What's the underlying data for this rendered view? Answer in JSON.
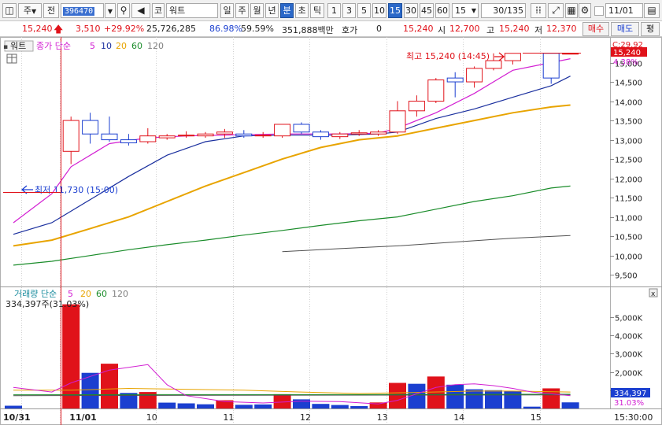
{
  "toolbar": {
    "market_type": "주",
    "prev_label": "전",
    "stock_code": "396470",
    "market_badge": "코",
    "stock_name": "워트",
    "period_buttons": [
      "일",
      "주",
      "월",
      "년",
      "분",
      "초",
      "틱"
    ],
    "selected_period": "분",
    "interval_buttons": [
      "1",
      "3",
      "5",
      "10",
      "15",
      "30",
      "45",
      "60"
    ],
    "selected_interval": "15",
    "interval_select": "15",
    "page_count": "30/135",
    "date": "11/01"
  },
  "quote": {
    "price": "15,240",
    "change": "3,510",
    "change_pct": "+29.92%",
    "volume": "25,726,285",
    "ratio1": "86.98%",
    "ratio2": "59.59%",
    "amount": "351,888백만",
    "hoga_label": "호가",
    "hoga_value": "0",
    "hoga_price": "15,240",
    "open_label": "시",
    "open": "12,700",
    "high_label": "고",
    "high": "15,240",
    "low_label": "저",
    "low": "12,370",
    "buy_button": "매수",
    "sell_button": "매도",
    "eval_button": "평"
  },
  "colors": {
    "up": "#e0121a",
    "down": "#1b3fd0",
    "ma5": "#d21ed2",
    "ma10": "#1a2f9e",
    "ma20": "#e8a400",
    "ma60": "#1a8c2a",
    "ma120": "#505050"
  },
  "price_panel": {
    "name_tag": "워트",
    "legend_title": "종가 단순",
    "legend_periods": [
      "5",
      "10",
      "20",
      "60",
      "120"
    ],
    "high_marker": "최고 15,240 (14:45)",
    "low_marker": "최저 11,730 (15:00)",
    "current_pct": "C:29.92",
    "current_price_tag": "15,240",
    "pct_tag": "4.38%"
  },
  "volume_panel": {
    "legend_title": "거래량 단순",
    "legend_periods": [
      "5",
      "20",
      "60",
      "120"
    ],
    "info": "334,397주(31.03%)",
    "current_tag": "334,397",
    "pct_tag": "31.03%",
    "close_icon": "x"
  },
  "time_axis": {
    "labels": [
      "10/31",
      "11/01",
      "10",
      "11",
      "12",
      "13",
      "14",
      "15"
    ],
    "last_time": "15:30:00"
  },
  "chart_data": {
    "type": "candlestick",
    "y_axis_ticks": [
      9500,
      10000,
      10500,
      11000,
      11500,
      12000,
      12500,
      13000,
      13500,
      14000,
      14500,
      15000
    ],
    "ylim": [
      9300,
      15500
    ],
    "volume_ticks": [
      "1,000K",
      "2,000K",
      "3,000K",
      "4,000K",
      "5,000K"
    ],
    "volume_ylim": [
      0,
      5900000
    ],
    "x_slots": 29,
    "candles": [
      {
        "i": 3,
        "o": 12700,
        "h": 13600,
        "l": 12370,
        "c": 13500
      },
      {
        "i": 4,
        "o": 13500,
        "h": 13700,
        "l": 12900,
        "c": 13150
      },
      {
        "i": 5,
        "o": 13150,
        "h": 13600,
        "l": 12950,
        "c": 13000
      },
      {
        "i": 6,
        "o": 13000,
        "h": 13150,
        "l": 12850,
        "c": 12920
      },
      {
        "i": 7,
        "o": 12950,
        "h": 13300,
        "l": 12900,
        "c": 13100
      },
      {
        "i": 8,
        "o": 13050,
        "h": 13150,
        "l": 13000,
        "c": 13100
      },
      {
        "i": 9,
        "o": 13100,
        "h": 13220,
        "l": 13050,
        "c": 13120
      },
      {
        "i": 10,
        "o": 13100,
        "h": 13200,
        "l": 13050,
        "c": 13150
      },
      {
        "i": 11,
        "o": 13150,
        "h": 13280,
        "l": 13050,
        "c": 13200
      },
      {
        "i": 12,
        "o": 13150,
        "h": 13250,
        "l": 13050,
        "c": 13100
      },
      {
        "i": 13,
        "o": 13100,
        "h": 13200,
        "l": 13050,
        "c": 13120
      },
      {
        "i": 14,
        "o": 13100,
        "h": 13400,
        "l": 13050,
        "c": 13400
      },
      {
        "i": 15,
        "o": 13400,
        "h": 13450,
        "l": 13150,
        "c": 13200
      },
      {
        "i": 16,
        "o": 13200,
        "h": 13250,
        "l": 13000,
        "c": 13080
      },
      {
        "i": 17,
        "o": 13080,
        "h": 13200,
        "l": 13020,
        "c": 13150
      },
      {
        "i": 18,
        "o": 13150,
        "h": 13250,
        "l": 13100,
        "c": 13180
      },
      {
        "i": 19,
        "o": 13150,
        "h": 13250,
        "l": 13100,
        "c": 13200
      },
      {
        "i": 20,
        "o": 13200,
        "h": 14000,
        "l": 13150,
        "c": 13750
      },
      {
        "i": 21,
        "o": 13750,
        "h": 14150,
        "l": 13600,
        "c": 14000
      },
      {
        "i": 22,
        "o": 14000,
        "h": 14600,
        "l": 13950,
        "c": 14550
      },
      {
        "i": 23,
        "o": 14600,
        "h": 14750,
        "l": 14100,
        "c": 14500
      },
      {
        "i": 24,
        "o": 14500,
        "h": 14900,
        "l": 14350,
        "c": 14850
      },
      {
        "i": 25,
        "o": 14850,
        "h": 15240,
        "l": 14800,
        "c": 15050
      },
      {
        "i": 26,
        "o": 15050,
        "h": 15240,
        "l": 14950,
        "c": 15240
      },
      {
        "i": 28,
        "o": 15240,
        "h": 15240,
        "l": 14450,
        "c": 14600
      },
      {
        "i": 29,
        "o": 15240,
        "h": 15240,
        "l": 15240,
        "c": 15240
      }
    ],
    "ma5": [
      [
        0,
        10850
      ],
      [
        2,
        11600
      ],
      [
        3,
        12300
      ],
      [
        5,
        12900
      ],
      [
        7,
        13050
      ],
      [
        9,
        13100
      ],
      [
        11,
        13120
      ],
      [
        14,
        13150
      ],
      [
        17,
        13150
      ],
      [
        19,
        13170
      ],
      [
        20,
        13300
      ],
      [
        22,
        13700
      ],
      [
        24,
        14200
      ],
      [
        26,
        14800
      ],
      [
        28,
        15000
      ],
      [
        29,
        15100
      ]
    ],
    "ma10": [
      [
        0,
        10550
      ],
      [
        2,
        10850
      ],
      [
        4,
        11450
      ],
      [
        6,
        12050
      ],
      [
        8,
        12600
      ],
      [
        10,
        12950
      ],
      [
        12,
        13100
      ],
      [
        14,
        13120
      ],
      [
        17,
        13120
      ],
      [
        19,
        13150
      ],
      [
        20,
        13200
      ],
      [
        22,
        13550
      ],
      [
        24,
        13800
      ],
      [
        26,
        14100
      ],
      [
        28,
        14400
      ],
      [
        29,
        14650
      ]
    ],
    "ma20": [
      [
        0,
        10250
      ],
      [
        2,
        10400
      ],
      [
        4,
        10700
      ],
      [
        6,
        11000
      ],
      [
        8,
        11400
      ],
      [
        10,
        11800
      ],
      [
        12,
        12150
      ],
      [
        14,
        12500
      ],
      [
        16,
        12800
      ],
      [
        18,
        13000
      ],
      [
        20,
        13100
      ],
      [
        22,
        13300
      ],
      [
        24,
        13500
      ],
      [
        26,
        13700
      ],
      [
        28,
        13850
      ],
      [
        29,
        13900
      ]
    ],
    "ma60": [
      [
        0,
        9750
      ],
      [
        2,
        9850
      ],
      [
        4,
        10000
      ],
      [
        6,
        10150
      ],
      [
        8,
        10280
      ],
      [
        10,
        10400
      ],
      [
        12,
        10530
      ],
      [
        14,
        10650
      ],
      [
        16,
        10780
      ],
      [
        18,
        10900
      ],
      [
        20,
        11000
      ],
      [
        22,
        11200
      ],
      [
        24,
        11400
      ],
      [
        26,
        11550
      ],
      [
        28,
        11750
      ],
      [
        29,
        11800
      ]
    ],
    "ma120": [
      [
        14,
        10100
      ],
      [
        17,
        10180
      ],
      [
        20,
        10250
      ],
      [
        23,
        10350
      ],
      [
        26,
        10450
      ],
      [
        29,
        10520
      ]
    ],
    "volume": [
      {
        "i": 0,
        "v": 150000,
        "up": false
      },
      {
        "i": 3,
        "v": 5700000,
        "up": true
      },
      {
        "i": 4,
        "v": 1950000,
        "up": false
      },
      {
        "i": 5,
        "v": 2450000,
        "up": true
      },
      {
        "i": 6,
        "v": 850000,
        "up": false
      },
      {
        "i": 7,
        "v": 900000,
        "up": true
      },
      {
        "i": 8,
        "v": 320000,
        "up": false
      },
      {
        "i": 9,
        "v": 280000,
        "up": false
      },
      {
        "i": 10,
        "v": 230000,
        "up": false
      },
      {
        "i": 11,
        "v": 450000,
        "up": true
      },
      {
        "i": 12,
        "v": 200000,
        "up": false
      },
      {
        "i": 13,
        "v": 220000,
        "up": false
      },
      {
        "i": 14,
        "v": 780000,
        "up": true
      },
      {
        "i": 15,
        "v": 500000,
        "up": false
      },
      {
        "i": 16,
        "v": 250000,
        "up": false
      },
      {
        "i": 17,
        "v": 190000,
        "up": false
      },
      {
        "i": 18,
        "v": 130000,
        "up": false
      },
      {
        "i": 19,
        "v": 330000,
        "up": true
      },
      {
        "i": 20,
        "v": 1400000,
        "up": true
      },
      {
        "i": 21,
        "v": 1350000,
        "up": false
      },
      {
        "i": 22,
        "v": 1750000,
        "up": true
      },
      {
        "i": 23,
        "v": 1300000,
        "up": false
      },
      {
        "i": 24,
        "v": 1050000,
        "up": false
      },
      {
        "i": 25,
        "v": 1000000,
        "up": false
      },
      {
        "i": 26,
        "v": 950000,
        "up": false
      },
      {
        "i": 27,
        "v": 100000,
        "up": false
      },
      {
        "i": 28,
        "v": 1100000,
        "up": true
      },
      {
        "i": 29,
        "v": 334397,
        "up": false
      }
    ],
    "vol_ma5": [
      [
        0,
        1150000
      ],
      [
        2,
        900000
      ],
      [
        3,
        1400000
      ],
      [
        5,
        2100000
      ],
      [
        7,
        2400000
      ],
      [
        8,
        1300000
      ],
      [
        9,
        700000
      ],
      [
        11,
        380000
      ],
      [
        13,
        300000
      ],
      [
        15,
        400000
      ],
      [
        17,
        380000
      ],
      [
        19,
        250000
      ],
      [
        20,
        450000
      ],
      [
        21,
        800000
      ],
      [
        22,
        1150000
      ],
      [
        23,
        1300000
      ],
      [
        24,
        1350000
      ],
      [
        25,
        1250000
      ],
      [
        26,
        1100000
      ],
      [
        27,
        900000
      ],
      [
        28,
        800000
      ],
      [
        29,
        700000
      ]
    ],
    "vol_ma20": [
      [
        0,
        1000000
      ],
      [
        3,
        1000000
      ],
      [
        6,
        1100000
      ],
      [
        9,
        1050000
      ],
      [
        12,
        1000000
      ],
      [
        15,
        900000
      ],
      [
        18,
        820000
      ],
      [
        21,
        880000
      ],
      [
        24,
        950000
      ],
      [
        26,
        950000
      ],
      [
        29,
        900000
      ]
    ],
    "vol_ma60": [
      [
        0,
        750000
      ],
      [
        6,
        760000
      ],
      [
        12,
        760000
      ],
      [
        18,
        760000
      ],
      [
        24,
        770000
      ],
      [
        29,
        780000
      ]
    ],
    "vol_ma120": [
      [
        0,
        700000
      ],
      [
        10,
        720000
      ],
      [
        20,
        730000
      ],
      [
        29,
        740000
      ]
    ]
  }
}
